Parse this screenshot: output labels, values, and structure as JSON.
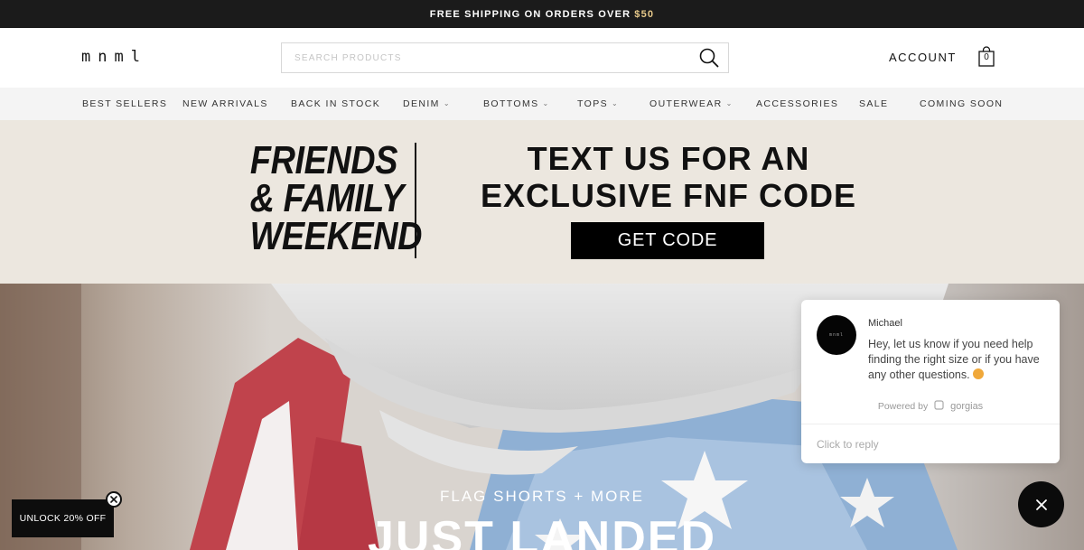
{
  "announcement": {
    "text": "FREE SHIPPING ON ORDERS OVER",
    "highlight": "$50",
    "highlight_color": "#e7c98a"
  },
  "header": {
    "logo": "mnml",
    "search": {
      "placeholder": "SEARCH PRODUCTS",
      "value": "",
      "icon": "search-icon"
    },
    "account_label": "ACCOUNT",
    "cart": {
      "icon": "shopping-bag-icon",
      "count": "0"
    }
  },
  "nav": {
    "items": [
      {
        "label": "BEST SELLERS",
        "dropdown": false
      },
      {
        "label": "NEW ARRIVALS",
        "dropdown": false
      },
      {
        "label": "BACK IN STOCK",
        "dropdown": false
      },
      {
        "label": "DENIM",
        "dropdown": true
      },
      {
        "label": "BOTTOMS",
        "dropdown": true
      },
      {
        "label": "TOPS",
        "dropdown": true
      },
      {
        "label": "OUTERWEAR",
        "dropdown": true
      },
      {
        "label": "ACCESSORIES",
        "dropdown": false
      },
      {
        "label": "SALE",
        "dropdown": false
      },
      {
        "label": "COMING SOON",
        "dropdown": false
      }
    ],
    "chevron": "⌄"
  },
  "promo": {
    "left_lines": [
      "FRIENDS",
      "& FAMILY",
      "WEEKEND"
    ],
    "right_lines": [
      "TEXT US FOR AN",
      "EXCLUSIVE FNF CODE"
    ],
    "button_label": "GET CODE",
    "background": "#ece7df"
  },
  "hero": {
    "subtitle": "FLAG SHORTS + MORE",
    "title": "JUST LANDED"
  },
  "chat": {
    "agent_name": "Michael",
    "message": "Hey, let us know if you need help finding the right size or if you have any other questions.",
    "powered_by_label": "Powered by",
    "powered_by_brand": "gorgias",
    "reply_placeholder": "Click to reply",
    "avatar_text": "mnml"
  },
  "unlock": {
    "label": "UNLOCK 20% OFF"
  },
  "icons": {
    "close": "×"
  }
}
